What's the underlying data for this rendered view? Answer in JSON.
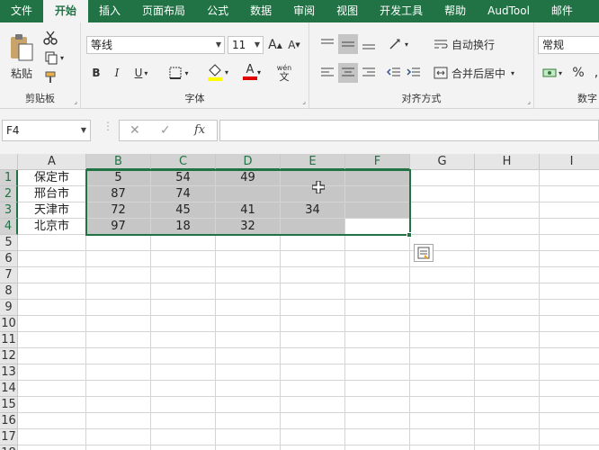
{
  "tabs": [
    "文件",
    "开始",
    "插入",
    "页面布局",
    "公式",
    "数据",
    "审阅",
    "视图",
    "开发工具",
    "帮助",
    "AudTool",
    "邮件"
  ],
  "active_tab": "开始",
  "clipboard": {
    "paste_label": "粘贴",
    "group_label": "剪贴板"
  },
  "font": {
    "name": "等线",
    "size": "11",
    "group_label": "字体",
    "bold": "B",
    "italic": "I",
    "underline": "U",
    "grow": "A",
    "shrink": "A",
    "fontcolor": "A",
    "phonetic_top": "wén",
    "phonetic_bottom": "文"
  },
  "alignment": {
    "wrap_label": "自动换行",
    "merge_label": "合并后居中",
    "group_label": "对齐方式"
  },
  "number": {
    "format": "常规",
    "percent": "%",
    "comma": ",",
    "group_label": "数字"
  },
  "namebox": "F4",
  "fx_label": "fx",
  "columns": [
    "A",
    "B",
    "C",
    "D",
    "E",
    "F",
    "G",
    "H",
    "I"
  ],
  "rows": [
    "1",
    "2",
    "3",
    "4",
    "5",
    "6",
    "7",
    "8",
    "9",
    "10",
    "11",
    "12",
    "13",
    "14",
    "15",
    "16",
    "17",
    "18"
  ],
  "cells": [
    [
      "保定市",
      "5",
      "54",
      "49",
      "",
      ""
    ],
    [
      "邢台市",
      "87",
      "74",
      "",
      "",
      ""
    ],
    [
      "天津市",
      "72",
      "45",
      "41",
      "34",
      ""
    ],
    [
      "北京市",
      "97",
      "18",
      "32",
      "",
      ""
    ]
  ],
  "colors": {
    "accent": "#217346",
    "selected": "#c6c6c6"
  }
}
